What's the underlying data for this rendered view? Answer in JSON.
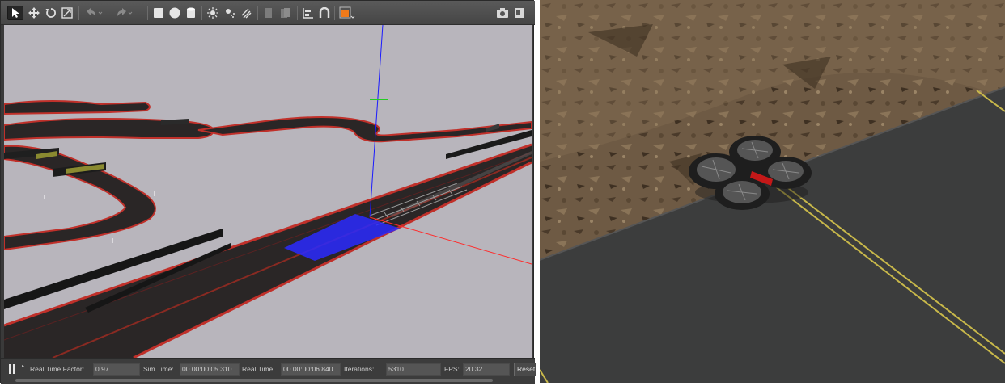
{
  "toolbar": {
    "tools": [
      {
        "name": "select-arrow-icon",
        "active": true
      },
      {
        "name": "translate-icon",
        "active": false
      },
      {
        "name": "rotate-icon",
        "active": false
      },
      {
        "name": "scale-icon",
        "active": false
      },
      {
        "name": "undo-icon",
        "active": false
      },
      {
        "name": "redo-icon",
        "active": false
      },
      {
        "name": "box-shape-icon",
        "active": false
      },
      {
        "name": "sphere-shape-icon",
        "active": false
      },
      {
        "name": "cylinder-shape-icon",
        "active": false
      },
      {
        "name": "point-light-icon",
        "active": false
      },
      {
        "name": "spot-light-icon",
        "active": false
      },
      {
        "name": "directional-light-icon",
        "active": false
      },
      {
        "name": "copy-icon",
        "active": false
      },
      {
        "name": "paste-icon",
        "active": false
      },
      {
        "name": "align-icon",
        "active": false
      },
      {
        "name": "snap-icon",
        "active": false
      },
      {
        "name": "view-angle-icon",
        "active": false
      },
      {
        "name": "screenshot-icon",
        "active": false
      },
      {
        "name": "record-log-icon",
        "active": false
      }
    ]
  },
  "statusbar": {
    "real_time_factor_label": "Real Time Factor:",
    "real_time_factor_value": "0.97",
    "sim_time_label": "Sim Time:",
    "sim_time_value": "00 00:00:05.310",
    "real_time_label": "Real Time:",
    "real_time_value": "00 00:00:06.840",
    "iterations_label": "Iterations:",
    "iterations_value": "5310",
    "fps_label": "FPS:",
    "fps_value": "20.32",
    "reset_label": "Reset"
  },
  "colors": {
    "viewport_bg": "#b8b5bc",
    "track": "#2a2626",
    "track_edge": "#c0302a",
    "selection": "#2a2aff",
    "ground": "#6e5a44",
    "asphalt": "#3c3d3d",
    "lane_line": "#c8b84a",
    "drone_body": "#1e1e1e",
    "drone_accent": "#c41818"
  }
}
